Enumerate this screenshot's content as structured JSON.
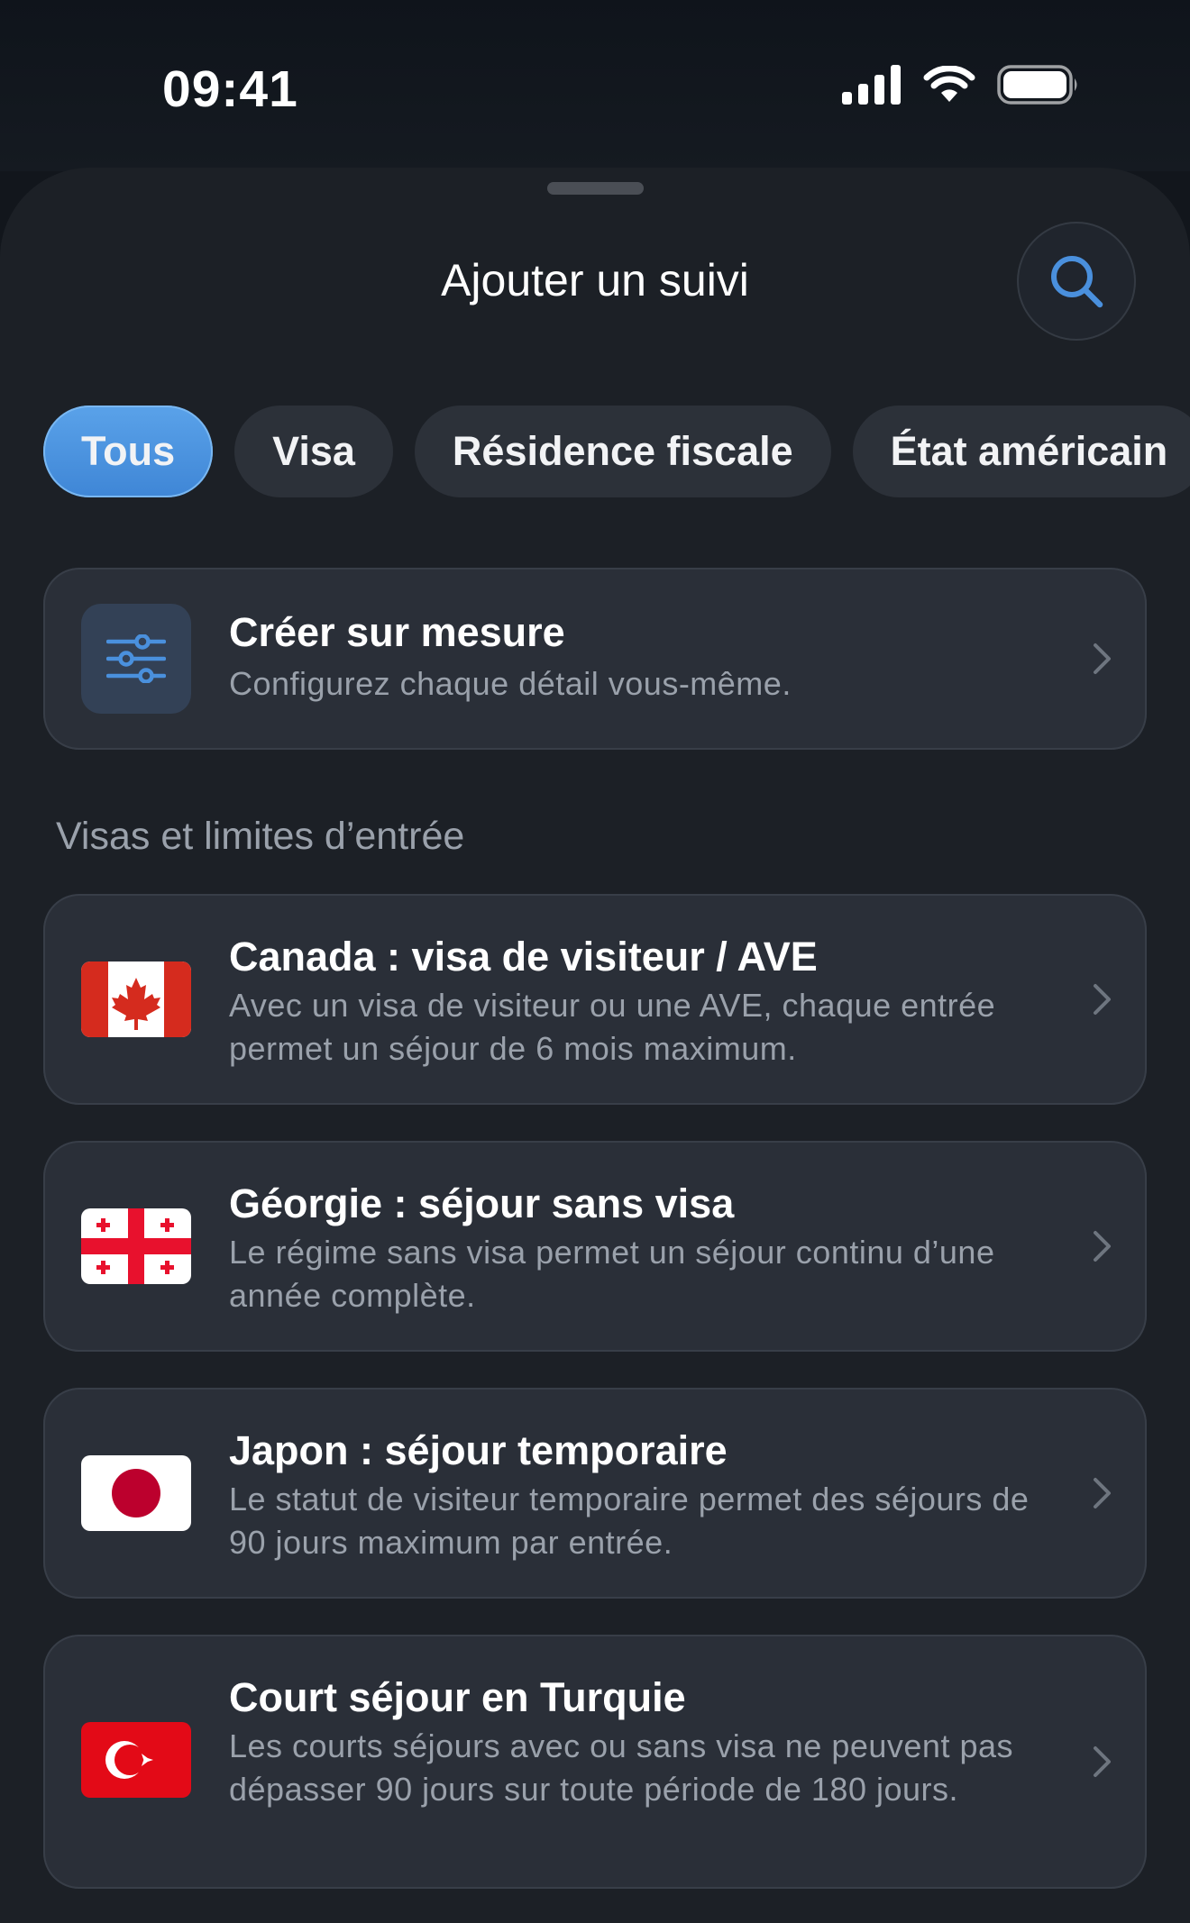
{
  "status_bar": {
    "time": "09:41"
  },
  "sheet": {
    "title": "Ajouter un suivi"
  },
  "filters": [
    {
      "label": "Tous",
      "active": true
    },
    {
      "label": "Visa",
      "active": false
    },
    {
      "label": "Résidence fiscale",
      "active": false
    },
    {
      "label": "État américain",
      "active": false
    }
  ],
  "custom": {
    "title": "Créer sur mesure",
    "description": "Configurez chaque détail vous-même.",
    "icon": "sliders-icon"
  },
  "section": {
    "title": "Visas et limites d’entrée"
  },
  "items": [
    {
      "flag": "canada-flag",
      "title": "Canada : visa de visiteur / AVE",
      "description": "Avec un visa de visiteur ou une AVE, chaque entrée permet un séjour de 6 mois maximum."
    },
    {
      "flag": "georgia-flag",
      "title": "Géorgie : séjour sans visa",
      "description": "Le régime sans visa permet un séjour continu d’une année complète."
    },
    {
      "flag": "japan-flag",
      "title": "Japon : séjour temporaire",
      "description": "Le statut de visiteur temporaire permet des séjours de 90 jours maximum par entrée."
    },
    {
      "flag": "turkey-flag",
      "title": "Court séjour en Turquie",
      "description": "Les courts séjours avec ou sans visa ne peuvent pas dépasser 90 jours sur toute période de 180 jours."
    }
  ],
  "colors": {
    "accent": "#4a90dd",
    "background": "#1c2026",
    "card": "#2a2f38",
    "secondary_text": "#9aa1ab"
  }
}
